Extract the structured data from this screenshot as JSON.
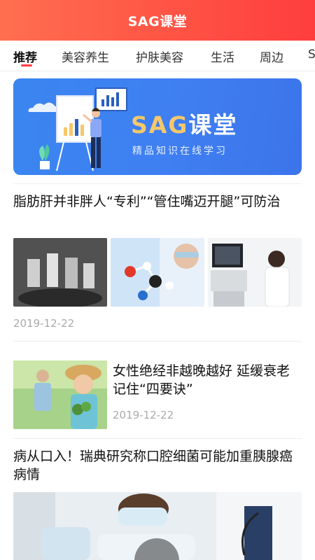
{
  "header": {
    "title": "SAG课堂"
  },
  "tabs": [
    {
      "label": "推荐"
    },
    {
      "label": "美容养生"
    },
    {
      "label": "护肤美容"
    },
    {
      "label": "生活"
    },
    {
      "label": "周边"
    },
    {
      "label": "S"
    }
  ],
  "banner": {
    "title_part1": "SAG",
    "title_part2": "课堂",
    "subtitle": "精品知识在线学习"
  },
  "articles": [
    {
      "title": "脂肪肝并非胖人“专利”“管住嘴迈开腿”可防治",
      "date": "2019-12-22"
    },
    {
      "title": "女性绝经非越晚越好 延缓衰老记住“四要诀”",
      "date": "2019-12-22"
    },
    {
      "title": "病从口入！瑞典研究称口腔细菌可能加重胰腺癌病情"
    }
  ],
  "colors": {
    "accent": "#ff3d3d",
    "banner": "#3f7ff2",
    "banner_title": "#f6c86b"
  }
}
